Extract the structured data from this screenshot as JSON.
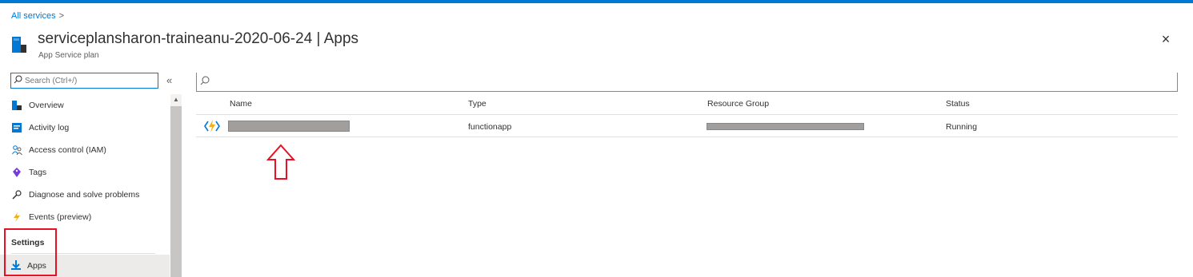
{
  "colors": {
    "accent": "#0078d4",
    "highlight": "#e81123",
    "function_icon": "#f2b01e"
  },
  "breadcrumb": {
    "link": "All services",
    "separator": ">"
  },
  "header": {
    "title": "serviceplansharon-traineanu-2020-06-24 | Apps",
    "subtitle": "App Service plan",
    "close_icon": "×"
  },
  "sidebar": {
    "search_placeholder": "Search (Ctrl+/)",
    "collapse_icon": "«",
    "items": [
      {
        "label": "Overview",
        "icon": "overview-icon"
      },
      {
        "label": "Activity log",
        "icon": "activity-log-icon"
      },
      {
        "label": "Access control (IAM)",
        "icon": "people-icon"
      },
      {
        "label": "Tags",
        "icon": "tag-icon"
      },
      {
        "label": "Diagnose and solve problems",
        "icon": "wrench-icon"
      },
      {
        "label": "Events (preview)",
        "icon": "lightning-icon"
      }
    ],
    "section_label": "Settings",
    "selected_item": {
      "label": "Apps",
      "icon": "download-icon"
    }
  },
  "main": {
    "columns": [
      "Name",
      "Type",
      "Resource Group",
      "Status"
    ],
    "rows": [
      {
        "name": "",
        "type": "functionapp",
        "resource_group": "",
        "status": "Running",
        "icon": "function-app-icon"
      }
    ]
  }
}
